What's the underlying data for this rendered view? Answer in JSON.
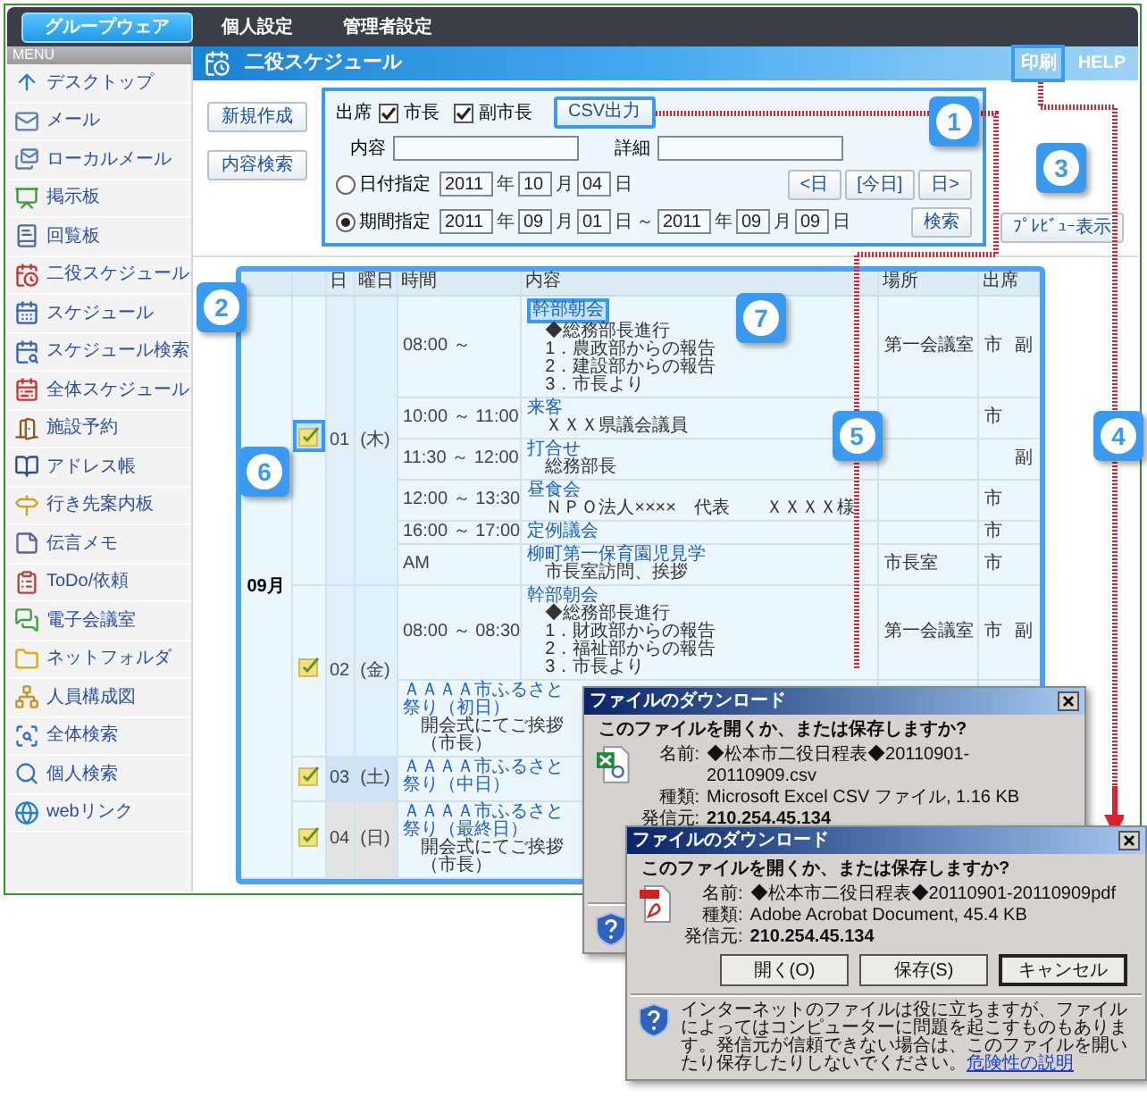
{
  "top_tabs": [
    {
      "label": "グループウェア",
      "selected": true
    },
    {
      "label": "個人設定",
      "selected": false
    },
    {
      "label": "管理者設定",
      "selected": false
    }
  ],
  "sidebar": {
    "heading": "MENU",
    "items": [
      {
        "label": "デスクトップ"
      },
      {
        "label": "メール"
      },
      {
        "label": "ローカルメール"
      },
      {
        "label": "掲示板"
      },
      {
        "label": "回覧板"
      },
      {
        "label": "二役スケジュール"
      },
      {
        "label": "スケジュール"
      },
      {
        "label": "スケジュール検索"
      },
      {
        "label": "全体スケジュール"
      },
      {
        "label": "施設予約"
      },
      {
        "label": "アドレス帳"
      },
      {
        "label": "行き先案内板"
      },
      {
        "label": "伝言メモ"
      },
      {
        "label": "ToDo/依頼"
      },
      {
        "label": "電子会議室"
      },
      {
        "label": "ネットフォルダ"
      },
      {
        "label": "人員構成図"
      },
      {
        "label": "全体検索"
      },
      {
        "label": "個人検索"
      },
      {
        "label": "webリンク"
      }
    ]
  },
  "page": {
    "title": "二役スケジュール",
    "links": [
      {
        "label": "印刷",
        "highlighted": true
      },
      {
        "label": "HELP",
        "highlighted": false
      }
    ]
  },
  "side_buttons": [
    "新規作成",
    "内容検索"
  ],
  "filter": {
    "attendance_label": "出席",
    "checkboxes": [
      {
        "label": "市長",
        "checked": true
      },
      {
        "label": "副市長",
        "checked": true
      }
    ],
    "csv_button": {
      "label": "CSV出力",
      "highlighted": true
    },
    "fields": [
      {
        "label": "内容"
      },
      {
        "label": "詳細"
      }
    ],
    "modes": [
      {
        "label": "日付指定",
        "selected": false,
        "parts": [
          {
            "kind": "input",
            "value": "2011"
          },
          {
            "kind": "text",
            "value": "年"
          },
          {
            "kind": "input",
            "value": "10"
          },
          {
            "kind": "text",
            "value": "月"
          },
          {
            "kind": "input",
            "value": "04"
          },
          {
            "kind": "text",
            "value": "日"
          }
        ],
        "buttons": [
          "<日",
          "[今日]",
          "日>"
        ]
      },
      {
        "label": "期間指定",
        "selected": true,
        "parts": [
          {
            "kind": "input",
            "value": "2011"
          },
          {
            "kind": "text",
            "value": "年"
          },
          {
            "kind": "input",
            "value": "09"
          },
          {
            "kind": "text",
            "value": "月"
          },
          {
            "kind": "input",
            "value": "01"
          },
          {
            "kind": "text",
            "value": "日"
          },
          {
            "kind": "text",
            "value": "～"
          },
          {
            "kind": "input",
            "value": "2011"
          },
          {
            "kind": "text",
            "value": "年"
          },
          {
            "kind": "input",
            "value": "09"
          },
          {
            "kind": "text",
            "value": "月"
          },
          {
            "kind": "input",
            "value": "09"
          },
          {
            "kind": "text",
            "value": "日"
          }
        ],
        "buttons": [
          "検索"
        ]
      }
    ]
  },
  "preview_button": "ﾌﾟﾚﾋﾞｭｰ表示",
  "callouts": [
    "1",
    "2",
    "3",
    "4",
    "5",
    "6",
    "7"
  ],
  "table": {
    "columns": [
      "日",
      "曜日",
      "時間",
      "内容",
      "場所",
      "出席"
    ],
    "month": "09月",
    "days": [
      {
        "day": "01",
        "weekday": "(木)",
        "kind": "weekday",
        "highlighted": true,
        "events": [
          {
            "kind": "timed",
            "time": "08:00 ～",
            "title": "幹部朝会",
            "highlighted": true,
            "details": [
              "◆総務部長進行",
              "1．農政部からの報告",
              "2．建設部からの報告",
              "3．市長より"
            ],
            "place": "第一会議室",
            "mayor": "市",
            "vice": "副"
          },
          {
            "kind": "timed",
            "time": "10:00 ～ 11:00",
            "title": "来客",
            "highlighted": false,
            "details": [
              "ＸＸＸ県議会議員"
            ],
            "mayor": "市"
          },
          {
            "kind": "timed",
            "time": "11:30 ～ 12:00",
            "title": "打合せ",
            "highlighted": false,
            "details": [
              "総務部長"
            ],
            "vice": "副"
          },
          {
            "kind": "timed",
            "time": "12:00 ～ 13:30",
            "title": "昼食会",
            "highlighted": false,
            "details": [
              "ＮＰＯ法人××××　代表　　ＸＸＸＸ様"
            ],
            "mayor": "市"
          },
          {
            "kind": "timed",
            "time": "16:00 ～ 17:00",
            "title": "定例議会",
            "highlighted": false,
            "mayor": "市"
          },
          {
            "kind": "timed",
            "time": "AM",
            "title": "柳町第一保育園児見学",
            "highlighted": false,
            "details": [
              "市長室訪問、挨拶"
            ],
            "place": "市長室",
            "mayor": "市"
          }
        ]
      },
      {
        "day": "02",
        "weekday": "(金)",
        "kind": "weekday",
        "highlighted": false,
        "events": [
          {
            "kind": "timed",
            "time": "08:00 ～ 08:30",
            "title": "幹部朝会",
            "highlighted": false,
            "details": [
              "◆総務部長進行",
              "1．財政部からの報告",
              "2．福祉部からの報告",
              "3．市長より"
            ],
            "place": "第一会議室",
            "mayor": "市",
            "vice": "副"
          },
          {
            "kind": "all_day",
            "title": "ＡＡＡＡ市ふるさと祭り（初日）",
            "highlighted": false,
            "details": [
              "開会式にてご挨拶（市長）"
            ]
          }
        ]
      },
      {
        "day": "03",
        "weekday": "(土)",
        "kind": "saturday",
        "highlighted": false,
        "events": [
          {
            "kind": "all_day",
            "title": "ＡＡＡＡ市ふるさと祭り（中日）",
            "highlighted": false
          }
        ]
      },
      {
        "day": "04",
        "weekday": "(日)",
        "kind": "sunday",
        "highlighted": false,
        "events": [
          {
            "kind": "all_day",
            "title": "ＡＡＡＡ市ふるさと祭り（最終日）",
            "highlighted": false,
            "details": [
              "開会式にてご挨拶（市長）"
            ]
          }
        ]
      }
    ]
  },
  "dialogs": [
    {
      "title": "ファイルのダウンロード",
      "kind": "csv",
      "question": "このファイルを開くか、または保存しますか?",
      "fields": [
        {
          "label": "名前:",
          "value": "◆松本市二役日程表◆20110901-20110909.csv"
        },
        {
          "label": "種類:",
          "value": "Microsoft Excel CSV ファイル, 1.16 KB"
        },
        {
          "label": "発信元:",
          "value": "210.254.45.134"
        }
      ]
    },
    {
      "title": "ファイルのダウンロード",
      "kind": "pdf",
      "question": "このファイルを開くか、または保存しますか?",
      "fields": [
        {
          "label": "名前:",
          "value": "◆松本市二役日程表◆20110901-20110909pdf"
        },
        {
          "label": "種類:",
          "value": "Adobe Acrobat Document, 45.4 KB"
        },
        {
          "label": "発信元:",
          "value": "210.254.45.134"
        }
      ],
      "buttons": [
        "開く(O)",
        "保存(S)",
        "キャンセル"
      ],
      "warning": {
        "text": "インターネットのファイルは役に立ちますが、ファイルによってはコンピューターに問題を起こすものもあります。発信元が信頼できない場合は、このファイルを開いたり保存したりしないでください。",
        "link": "危険性の説明"
      }
    }
  ]
}
